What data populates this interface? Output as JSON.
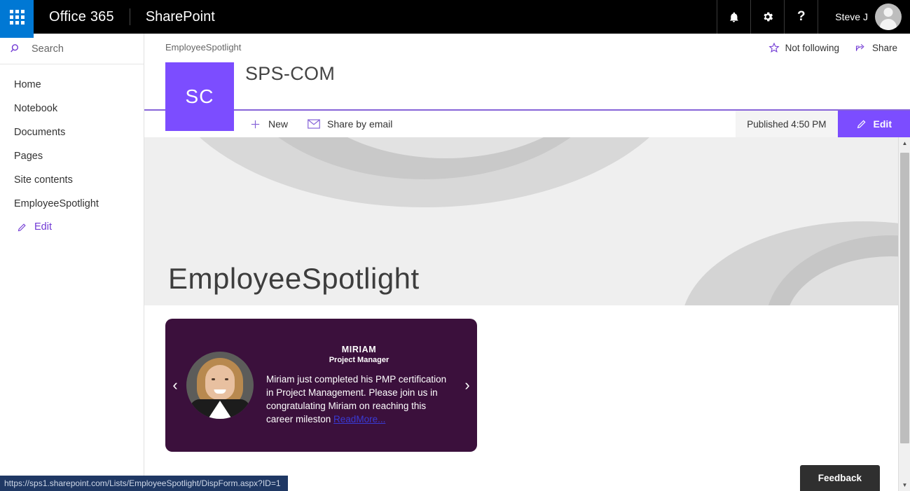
{
  "suite": {
    "waffle_label": "app-launcher",
    "brand": "Office 365",
    "app": "SharePoint",
    "notifications_icon": "bell-icon",
    "settings_icon": "gear-icon",
    "help_icon": "question-mark-icon",
    "user_name": "Steve J"
  },
  "leftnav": {
    "search_placeholder": "Search",
    "search_value": "",
    "items": [
      {
        "label": "Home"
      },
      {
        "label": "Notebook"
      },
      {
        "label": "Documents"
      },
      {
        "label": "Pages"
      },
      {
        "label": "Site contents"
      },
      {
        "label": "EmployeeSpotlight"
      }
    ],
    "edit_label": "Edit"
  },
  "site": {
    "breadcrumb": "EmployeeSpotlight",
    "logo_initials": "SC",
    "title": "SPS-COM",
    "follow_label": "Not following",
    "share_label": "Share"
  },
  "commandbar": {
    "new_label": "New",
    "share_email_label": "Share by email",
    "published_label": "Published 4:50 PM",
    "edit_label": "Edit"
  },
  "page": {
    "hero_title": "EmployeeSpotlight"
  },
  "spotlight": {
    "prev_arrow": "‹",
    "next_arrow": "›",
    "name": "MIRIAM",
    "role": "Project Manager",
    "text": "Miriam just completed his PMP certification in Project Management. Please join us in congratulating Miriam on reaching this career mileston ",
    "link_label": "ReadMore..."
  },
  "footer": {
    "feedback_label": "Feedback",
    "status_url": "https://sps1.sharepoint.com/Lists/EmployeeSpotlight/DispForm.aspx?ID=1"
  },
  "colors": {
    "accent_purple": "#7c4dff",
    "suite_blue": "#0078D4",
    "card_purple": "#3b103c",
    "link_blue": "#3a3ad6",
    "status_navy": "#1f3864"
  }
}
